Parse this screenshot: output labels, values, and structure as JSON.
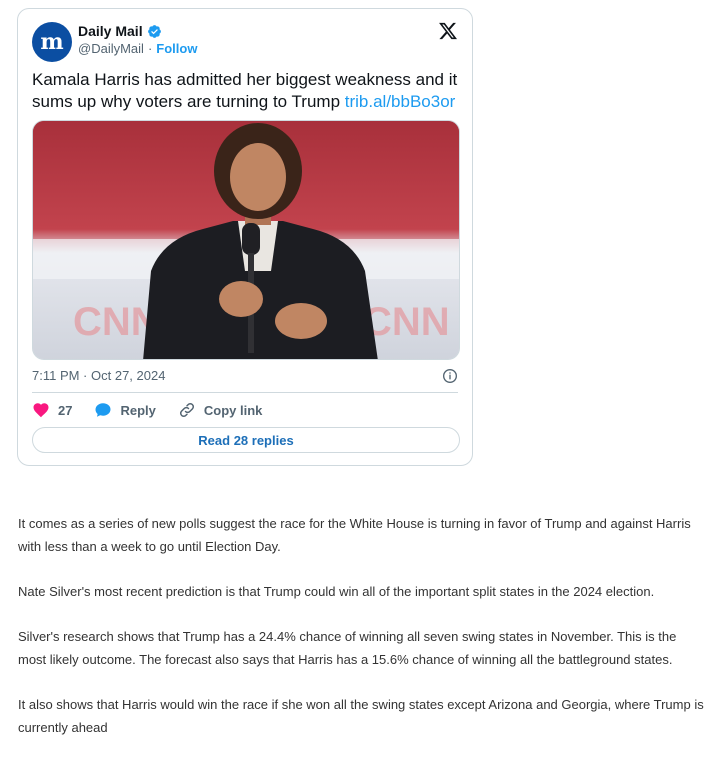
{
  "tweet": {
    "author_name": "Daily Mail",
    "handle": "@DailyMail",
    "separator": "·",
    "follow_label": "Follow",
    "text": "Kamala Harris has admitted her biggest weakness and it sums up why voters are turning to Trump",
    "link_text": "trib.al/bbBo3or",
    "timestamp": "7:11 PM · Oct 27, 2024",
    "likes_count": "27",
    "reply_label": "Reply",
    "copy_link_label": "Copy link",
    "read_replies_label": "Read 28 replies",
    "icons": {
      "avatar": "daily-mail-logo",
      "verified": "verified-badge-icon",
      "platform": "x-logo-icon",
      "like": "heart-icon",
      "reply": "speech-bubble-icon",
      "copy": "link-icon",
      "info": "info-icon"
    },
    "colors": {
      "accent": "#1d9bf0",
      "heart": "#f91880",
      "avatar_bg": "#0b4ea2"
    }
  },
  "article": {
    "paragraphs": [
      "It comes as a series of new polls suggest the race for the White House is turning in favor of Trump and against Harris with less than a week to go until Election Day.",
      "Nate Silver's most recent prediction is that Trump could win all of the important split states in the 2024 election.",
      "Silver's research shows that Trump has a 24.4% chance of winning all seven swing states in November. This is the most likely outcome. The forecast also says that Harris has a 15.6% chance of winning all the battleground states.",
      "It also shows that Harris would win the race if she won all the swing states except Arizona and Georgia, where Trump is currently ahead"
    ]
  }
}
